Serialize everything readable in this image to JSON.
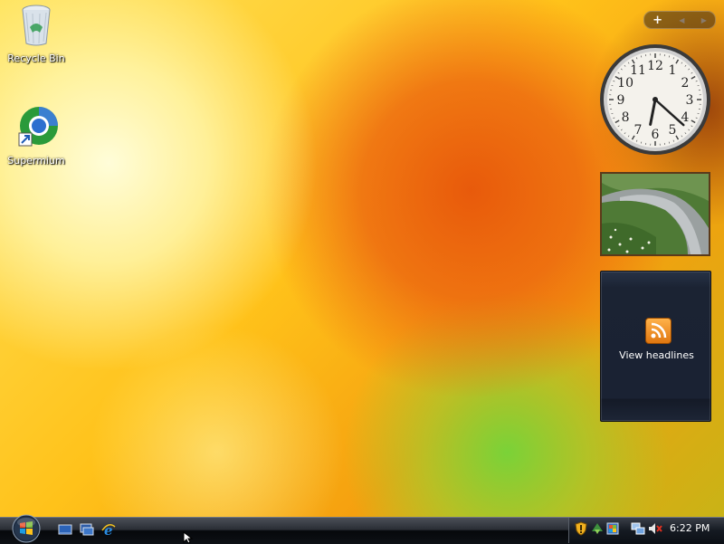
{
  "desktop": {
    "icons": [
      {
        "label": "Recycle Bin",
        "icon": "recycle-bin-icon"
      },
      {
        "label": "Supermium",
        "icon": "supermium-icon"
      }
    ]
  },
  "sidebar": {
    "add_gadget": "+",
    "prev": "◀",
    "next": "▶",
    "clock": {
      "numerals": [
        "12",
        "1",
        "2",
        "3",
        "4",
        "5",
        "6",
        "7",
        "8",
        "9",
        "10",
        "11"
      ],
      "hour": 6,
      "minute": 22
    },
    "feed": {
      "label": "View headlines",
      "icon": "rss-icon"
    }
  },
  "taskbar": {
    "start": "start-orb-icon",
    "quick_launch": [
      "show-desktop-icon",
      "switch-windows-icon",
      "internet-explorer-icon"
    ],
    "tray_icons": [
      "security-shield-icon",
      "windows-update-icon",
      "defender-icon",
      "network-icon",
      "volume-muted-icon"
    ],
    "time": "6:22 PM"
  },
  "colors": {
    "accent_orange": "#f29a10",
    "taskbar_dark": "#0d1015"
  }
}
